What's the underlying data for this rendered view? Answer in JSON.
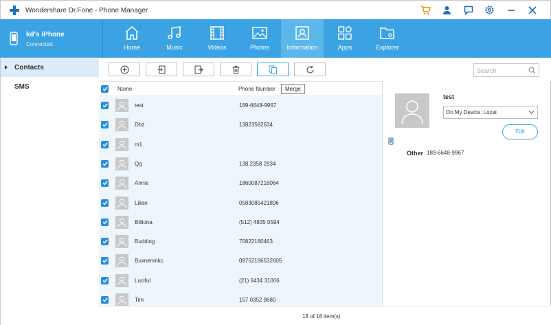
{
  "app": {
    "title": "Wondershare Dr.Fone - Phone Manager",
    "accent_color": "#3ba3e3",
    "logo_color": "#1e6fb6",
    "titlebar_icons": [
      {
        "icon": "cart-icon",
        "color": "#f08a00"
      },
      {
        "icon": "user-icon",
        "color": "#1e6fb6"
      },
      {
        "icon": "chat-icon",
        "color": "#1e6fb6"
      },
      {
        "icon": "settings-icon",
        "color": "#1e6fb6"
      },
      {
        "icon": "minimize-icon",
        "color": "#1e6fb6"
      },
      {
        "icon": "close-icon",
        "color": "#1e6fb6"
      }
    ]
  },
  "device": {
    "name": "kd's iPhone",
    "status": "Connected"
  },
  "nav": {
    "tabs": [
      {
        "label": "Home",
        "icon": "home-icon"
      },
      {
        "label": "Music",
        "icon": "music-icon"
      },
      {
        "label": "Videos",
        "icon": "video-icon"
      },
      {
        "label": "Photos",
        "icon": "photo-icon"
      },
      {
        "label": "Information",
        "icon": "contact-card-icon",
        "active": true
      },
      {
        "label": "Apps",
        "icon": "apps-icon"
      },
      {
        "label": "Explorer",
        "icon": "folder-icon"
      }
    ]
  },
  "sidebar": {
    "items": [
      {
        "label": "Contacts",
        "active": true
      },
      {
        "label": "SMS"
      }
    ]
  },
  "toolbar": {
    "buttons": [
      {
        "icon": "add-icon"
      },
      {
        "icon": "import-icon"
      },
      {
        "icon": "export-icon"
      },
      {
        "icon": "delete-icon"
      },
      {
        "icon": "merge-icon",
        "active": true
      },
      {
        "icon": "refresh-icon"
      }
    ],
    "tooltip": "Merge",
    "search_placeholder": "Search"
  },
  "list": {
    "columns": {
      "name": "Name",
      "phone": "Phone Number"
    },
    "rows": [
      {
        "name": "test",
        "phone": "189-6648-9967"
      },
      {
        "name": "Dbz",
        "phone": "13823582634"
      },
      {
        "name": "m1",
        "phone": ""
      },
      {
        "name": "Qq",
        "phone": "138 2358 2934"
      },
      {
        "name": "Annie",
        "phone": "1860087218064"
      },
      {
        "name": "Lilian",
        "phone": "0583085421896"
      },
      {
        "name": "Billiona",
        "phone": "(512) 4835 0594"
      },
      {
        "name": "Budding",
        "phone": "70822180463"
      },
      {
        "name": "Buxnenmkc",
        "phone": "08752186532605"
      },
      {
        "name": "Luciful",
        "phone": "(21) 6434 31006"
      },
      {
        "name": "Tim",
        "phone": "157 0352 9680"
      }
    ]
  },
  "footer": {
    "status": "18  of  18  item(s)"
  },
  "detail": {
    "name": "test",
    "storage": "On My Device: Local",
    "edit_label": "Edit",
    "field_label": "Other",
    "field_value": "189-6648-9967"
  }
}
